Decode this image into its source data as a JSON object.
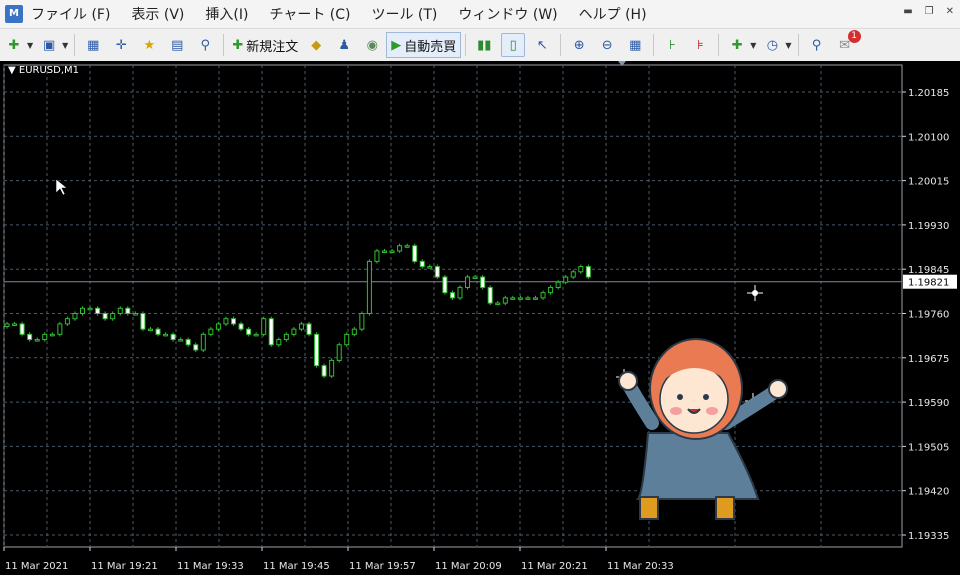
{
  "menubar": {
    "items": [
      "ファイル (F)",
      "表示 (V)",
      "挿入(I)",
      "チャート (C)",
      "ツール (T)",
      "ウィンドウ (W)",
      "ヘルプ (H)"
    ]
  },
  "toolbar": {
    "new_order_label": "新規注文",
    "autotrade_label": "自動売買",
    "notification_count": "1"
  },
  "chart": {
    "symbol_label": "EURUSD,M1",
    "current_price_label": "1.19821",
    "colors": {
      "background": "#000000",
      "grid": "#4a5a6a",
      "candle_bull": "#2fbf2f",
      "candle_bear": "#ffffff",
      "price_line": "#7f8aa0"
    }
  },
  "chart_data": {
    "type": "candlestick",
    "symbol": "EURUSD",
    "timeframe": "M1",
    "y_ticks": [
      1.20185,
      1.201,
      1.20015,
      1.1993,
      1.19845,
      1.1976,
      1.19675,
      1.1959,
      1.19505,
      1.1942,
      1.19335
    ],
    "ylim": [
      1.1929,
      1.2024
    ],
    "x_tick_labels": [
      "11 Mar 2021",
      "11 Mar 19:21",
      "11 Mar 19:33",
      "11 Mar 19:45",
      "11 Mar 19:57",
      "11 Mar 20:09",
      "11 Mar 20:21",
      "11 Mar 20:33"
    ],
    "current_price": 1.19821,
    "closes": [
      1.1974,
      1.1974,
      1.1972,
      1.1971,
      1.1971,
      1.1972,
      1.1972,
      1.1974,
      1.1975,
      1.1976,
      1.1977,
      1.1977,
      1.1976,
      1.1975,
      1.1976,
      1.1977,
      1.1976,
      1.1976,
      1.1973,
      1.1973,
      1.1972,
      1.1972,
      1.1971,
      1.1971,
      1.197,
      1.1969,
      1.1972,
      1.1973,
      1.1974,
      1.1975,
      1.1974,
      1.1973,
      1.1972,
      1.1972,
      1.1975,
      1.197,
      1.1971,
      1.1972,
      1.1973,
      1.1974,
      1.1972,
      1.1966,
      1.1964,
      1.1967,
      1.197,
      1.1972,
      1.1973,
      1.1976,
      1.1986,
      1.1988,
      1.1988,
      1.1988,
      1.1989,
      1.1989,
      1.1986,
      1.1985,
      1.1985,
      1.1983,
      1.198,
      1.1979,
      1.1981,
      1.1983,
      1.1983,
      1.1981,
      1.1978,
      1.1978,
      1.1979,
      1.1979,
      1.1979,
      1.1979,
      1.1979,
      1.198,
      1.1981,
      1.1982,
      1.1983,
      1.1984,
      1.1985,
      1.1983
    ]
  }
}
